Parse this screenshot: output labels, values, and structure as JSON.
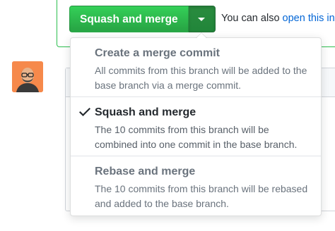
{
  "merge_button": {
    "label": "Squash and merge",
    "dropdown_icon": "caret-down-icon"
  },
  "also_text": {
    "prefix": "You can also ",
    "link": "open this in G"
  },
  "avatar": {
    "icon": "avatar-portrait"
  },
  "menu": {
    "items": [
      {
        "title": "Create a merge commit",
        "description": "All commits from this branch will be added to the base branch via a merge commit.",
        "selected": false
      },
      {
        "title": "Squash and merge",
        "description": "The 10 commits from this branch will be combined into one commit in the base branch.",
        "selected": true
      },
      {
        "title": "Rebase and merge",
        "description": "The 10 commits from this branch will be rebased and added to the base branch.",
        "selected": false
      }
    ],
    "check_icon": "check-icon"
  },
  "colors": {
    "green_button": "#2ea44f",
    "link": "#0366d6",
    "avatar_bg": "#f6894b"
  }
}
